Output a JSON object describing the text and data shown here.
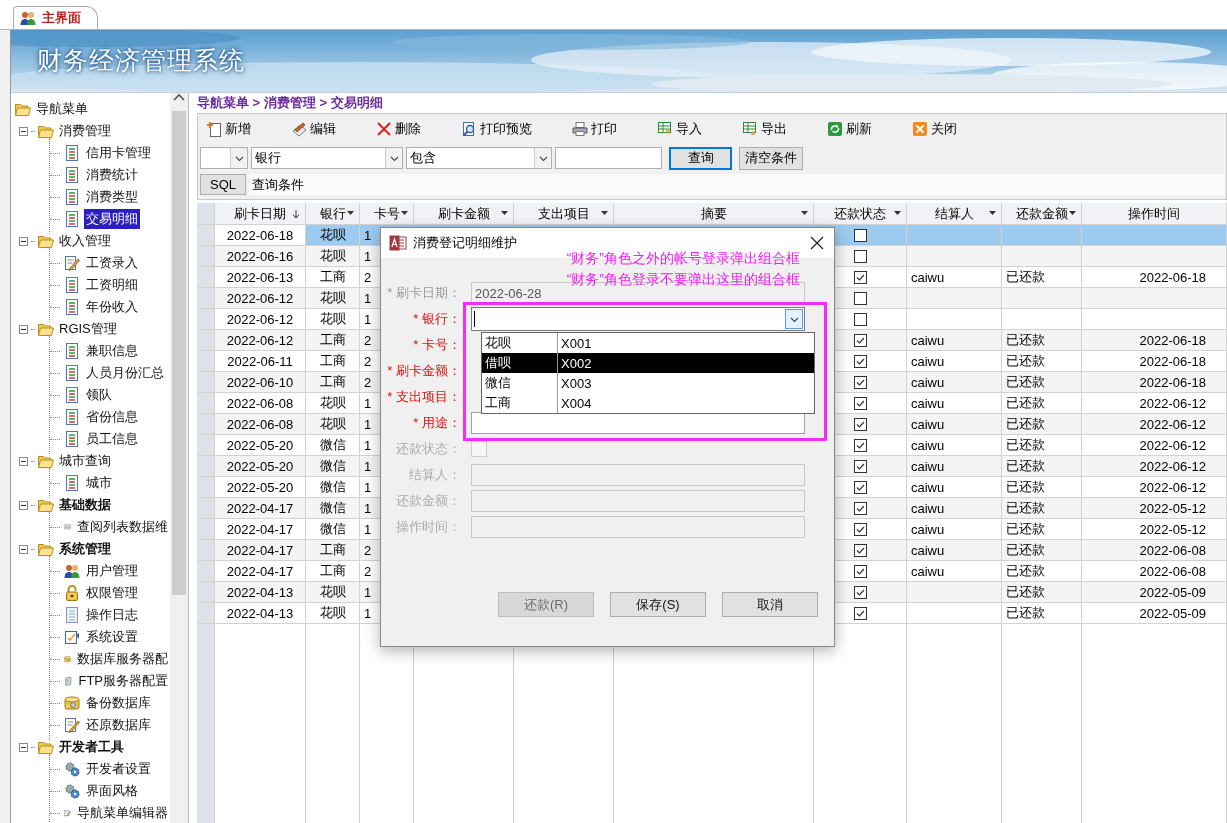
{
  "tab": {
    "label": "主界面",
    "selected": true
  },
  "banner": {
    "title": "财务经济管理系统",
    "kind": "picture"
  },
  "nav": {
    "root": "导航菜单",
    "groups": [
      {
        "label": "消费管理",
        "bold": false,
        "expanded": true,
        "children": [
          {
            "label": "信用卡管理",
            "kind": "doc",
            "selected": false
          },
          {
            "label": "消费统计",
            "kind": "doc",
            "selected": false
          },
          {
            "label": "消费类型",
            "kind": "doc",
            "selected": false
          },
          {
            "label": "交易明细",
            "kind": "doc",
            "selected": true
          }
        ]
      },
      {
        "label": "收入管理",
        "bold": false,
        "expanded": true,
        "children": [
          {
            "label": "工资录入",
            "kind": "edit",
            "selected": false
          },
          {
            "label": "工资明细",
            "kind": "doc",
            "selected": false
          },
          {
            "label": "年份收入",
            "kind": "doc",
            "selected": false
          }
        ]
      },
      {
        "label": "RGIS管理",
        "bold": false,
        "expanded": true,
        "children": [
          {
            "label": "兼职信息",
            "kind": "doc",
            "selected": false
          },
          {
            "label": "人员月份汇总",
            "kind": "doc",
            "selected": false
          },
          {
            "label": "领队",
            "kind": "doc",
            "selected": false
          },
          {
            "label": "省份信息",
            "kind": "doc",
            "selected": false
          },
          {
            "label": "员工信息",
            "kind": "doc",
            "selected": false
          }
        ]
      },
      {
        "label": "城市查询",
        "bold": false,
        "expanded": true,
        "children": [
          {
            "label": "城市",
            "kind": "doc",
            "selected": false
          }
        ]
      },
      {
        "label": "基础数据",
        "bold": true,
        "expanded": true,
        "children": [
          {
            "label": "查阅列表数据维",
            "kind": "grid",
            "selected": false
          }
        ]
      },
      {
        "label": "系统管理",
        "bold": true,
        "expanded": true,
        "children": [
          {
            "label": "用户管理",
            "kind": "users",
            "selected": false
          },
          {
            "label": "权限管理",
            "kind": "lock",
            "selected": false
          },
          {
            "label": "操作日志",
            "kind": "log",
            "selected": false
          },
          {
            "label": "系统设置",
            "kind": "settings",
            "selected": false
          },
          {
            "label": "数据库服务器配",
            "kind": "database",
            "selected": false
          },
          {
            "label": "FTP服务器配置",
            "kind": "server",
            "selected": false
          },
          {
            "label": "备份数据库",
            "kind": "database",
            "selected": false
          },
          {
            "label": "还原数据库",
            "kind": "edit",
            "selected": false
          }
        ]
      },
      {
        "label": "开发者工具",
        "bold": true,
        "expanded": true,
        "children": [
          {
            "label": "开发者设置",
            "kind": "gears",
            "selected": false
          },
          {
            "label": "界面风格",
            "kind": "gears",
            "selected": false
          },
          {
            "label": "导航菜单编辑器",
            "kind": "edit",
            "selected": false
          }
        ]
      }
    ]
  },
  "breadcrumb": "导航菜单 > 消费管理 > 交易明细",
  "toolbar": [
    {
      "label": "新增",
      "kind": "add"
    },
    {
      "label": "编辑",
      "kind": "edit"
    },
    {
      "label": "删除",
      "kind": "delete"
    },
    {
      "label": "打印预览",
      "kind": "preview"
    },
    {
      "label": "打印",
      "kind": "print"
    },
    {
      "label": "导入",
      "kind": "import"
    },
    {
      "label": "导出",
      "kind": "export"
    },
    {
      "label": "刷新",
      "kind": "refresh"
    },
    {
      "label": "关闭",
      "kind": "close"
    }
  ],
  "filter_bar": [
    {
      "kind": "combo"
    },
    {
      "kind": "combo",
      "value": "银行"
    },
    {
      "kind": "combo",
      "value": "包含"
    },
    {
      "kind": "input"
    },
    {
      "kind": "button",
      "label": "查询",
      "focused": true
    },
    {
      "kind": "button",
      "label": "清空条件",
      "focused": false
    }
  ],
  "sql_bar": {
    "button": "SQL",
    "label": "查询条件"
  },
  "grid": {
    "columns": [
      {
        "label": "刷卡日期",
        "kind": "sorted"
      },
      {
        "label": "银行",
        "kind": "filter"
      },
      {
        "label": "卡号",
        "kind": "filter"
      },
      {
        "label": "刷卡金额",
        "kind": "filter"
      },
      {
        "label": "支出项目",
        "kind": "filter"
      },
      {
        "label": "摘要",
        "kind": "filter"
      },
      {
        "label": "还款状态",
        "kind": "filter"
      },
      {
        "label": "结算人",
        "kind": "filter"
      },
      {
        "label": "还款金额",
        "kind": "filter"
      },
      {
        "label": "操作时间",
        "kind": "plain"
      }
    ],
    "rows": [
      {
        "date": "2022-06-18",
        "bank": "花呗",
        "card": "1",
        "repaid": false,
        "selected": true
      },
      {
        "date": "2022-06-16",
        "bank": "花呗",
        "card": "1",
        "repaid": false,
        "selected": false
      },
      {
        "date": "2022-06-13",
        "bank": "工商",
        "card": "2",
        "repaid": true,
        "settler": "caiwu",
        "repay_status": "已还款",
        "op_time": "2022-06-18",
        "selected": false
      },
      {
        "date": "2022-06-12",
        "bank": "花呗",
        "card": "1",
        "repaid": false,
        "selected": false
      },
      {
        "date": "2022-06-12",
        "bank": "花呗",
        "card": "1",
        "repaid": false,
        "selected": false
      },
      {
        "date": "2022-06-12",
        "bank": "工商",
        "card": "2",
        "repaid": true,
        "settler": "caiwu",
        "repay_status": "已还款",
        "op_time": "2022-06-18",
        "selected": false
      },
      {
        "date": "2022-06-11",
        "bank": "工商",
        "card": "2",
        "repaid": true,
        "settler": "caiwu",
        "repay_status": "已还款",
        "op_time": "2022-06-18",
        "selected": false
      },
      {
        "date": "2022-06-10",
        "bank": "工商",
        "card": "2",
        "repaid": true,
        "settler": "caiwu",
        "repay_status": "已还款",
        "op_time": "2022-06-18",
        "selected": false
      },
      {
        "date": "2022-06-08",
        "bank": "花呗",
        "card": "1",
        "repaid": true,
        "settler": "caiwu",
        "repay_status": "已还款",
        "op_time": "2022-06-12",
        "selected": false
      },
      {
        "date": "2022-06-08",
        "bank": "花呗",
        "card": "1",
        "repaid": true,
        "settler": "caiwu",
        "repay_status": "已还款",
        "op_time": "2022-06-12",
        "selected": false
      },
      {
        "date": "2022-05-20",
        "bank": "微信",
        "card": "1",
        "repaid": true,
        "settler": "caiwu",
        "repay_status": "已还款",
        "op_time": "2022-06-12",
        "selected": false
      },
      {
        "date": "2022-05-20",
        "bank": "微信",
        "card": "1",
        "repaid": true,
        "settler": "caiwu",
        "repay_status": "已还款",
        "op_time": "2022-06-12",
        "selected": false
      },
      {
        "date": "2022-05-20",
        "bank": "微信",
        "card": "1",
        "repaid": true,
        "settler": "caiwu",
        "repay_status": "已还款",
        "op_time": "2022-06-12",
        "selected": false
      },
      {
        "date": "2022-04-17",
        "bank": "微信",
        "card": "1",
        "repaid": true,
        "settler": "caiwu",
        "repay_status": "已还款",
        "op_time": "2022-05-12",
        "selected": false
      },
      {
        "date": "2022-04-17",
        "bank": "微信",
        "card": "1",
        "repaid": true,
        "settler": "caiwu",
        "repay_status": "已还款",
        "op_time": "2022-05-12",
        "selected": false
      },
      {
        "date": "2022-04-17",
        "bank": "工商",
        "card": "2",
        "repaid": true,
        "settler": "caiwu",
        "repay_status": "已还款",
        "op_time": "2022-06-08",
        "selected": false
      },
      {
        "date": "2022-04-17",
        "bank": "工商",
        "card": "2",
        "repaid": true,
        "settler": "caiwu",
        "repay_status": "已还款",
        "op_time": "2022-06-08",
        "selected": false
      },
      {
        "date": "2022-04-13",
        "bank": "花呗",
        "card": "1",
        "repaid": true,
        "repay_status": "已还款",
        "op_time": "2022-05-09",
        "selected": false
      },
      {
        "date": "2022-04-13",
        "bank": "花呗",
        "card": "1",
        "repaid": true,
        "repay_status": "已还款",
        "op_time": "2022-05-09",
        "selected": false
      }
    ]
  },
  "dialog": {
    "title": "消费登记明细维护",
    "annotation": [
      "“财务”角色之外的帐号登录弹出组合框",
      "“财务”角色登录不要弹出这里的组合框"
    ],
    "fields": [
      {
        "label": "* 刷卡日期：",
        "kind": "text",
        "required": true,
        "disabled": true,
        "value": "2022-06-28"
      },
      {
        "label": "* 银行：",
        "kind": "combo",
        "required": true,
        "disabled": false
      },
      {
        "label": "* 卡号：",
        "kind": "label",
        "required": true,
        "disabled": false
      },
      {
        "label": "* 刷卡金额：",
        "kind": "label",
        "required": true,
        "disabled": false
      },
      {
        "label": "* 支出项目：",
        "kind": "label",
        "required": true,
        "disabled": false
      },
      {
        "label": "* 用途：",
        "kind": "text",
        "required": true,
        "disabled": false
      },
      {
        "label": "还款状态：",
        "kind": "checkbox",
        "required": false,
        "disabled": true,
        "checked": false
      },
      {
        "label": "结算人：",
        "kind": "text",
        "required": false,
        "disabled": true
      },
      {
        "label": "还款金额：",
        "kind": "text",
        "required": false,
        "disabled": true
      },
      {
        "label": "操作时间：",
        "kind": "text",
        "required": false,
        "disabled": true
      }
    ],
    "dropdown": [
      {
        "name": "花呗",
        "code": "X001",
        "selected": false
      },
      {
        "name": "借呗",
        "code": "X002",
        "selected": true
      },
      {
        "name": "微信",
        "code": "X003",
        "selected": false
      },
      {
        "name": "工商",
        "code": "X004",
        "selected": false
      }
    ],
    "buttons": [
      {
        "label": "还款(R)",
        "disabled": true
      },
      {
        "label": "保存(S)",
        "disabled": false
      },
      {
        "label": "取消",
        "disabled": false
      }
    ]
  }
}
